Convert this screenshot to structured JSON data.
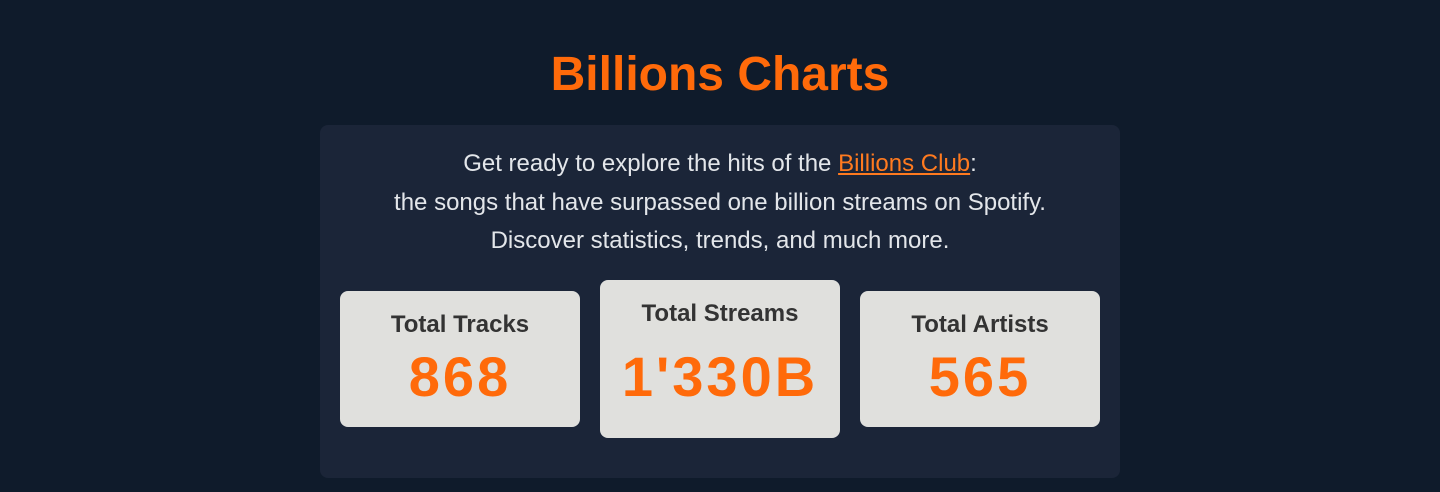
{
  "header": {
    "title": "Billions Charts"
  },
  "intro": {
    "prefix": "Get ready to explore the hits of the ",
    "link_text": "Billions Club",
    "suffix": ":",
    "line2": "the songs that have surpassed one billion streams on Spotify.",
    "line3": "Discover statistics, trends, and much more."
  },
  "stats": {
    "tracks": {
      "label": "Total Tracks",
      "value": "868"
    },
    "streams": {
      "label": "Total Streams",
      "value": "1'330B"
    },
    "artists": {
      "label": "Total Artists",
      "value": "565"
    }
  },
  "colors": {
    "accent": "#ff6a0a",
    "background": "#0f1b2b",
    "panel": "#1b2538",
    "card": "#e0e0dd"
  }
}
